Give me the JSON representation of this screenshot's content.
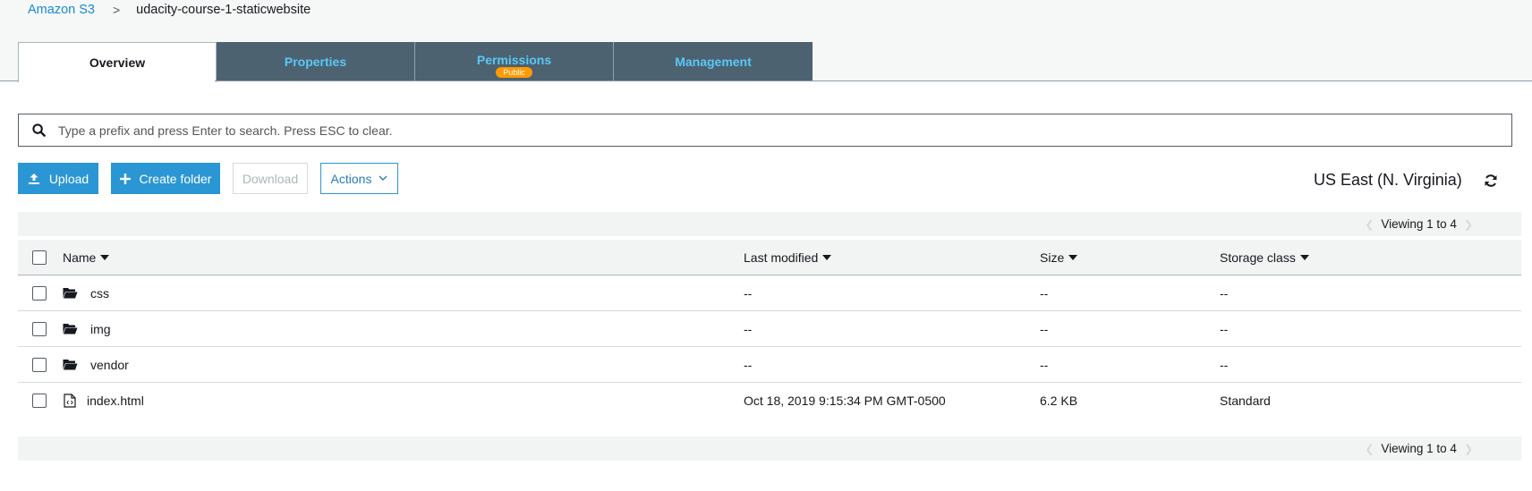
{
  "breadcrumb": {
    "root": "Amazon S3",
    "separator": ">",
    "current": "udacity-course-1-staticwebsite"
  },
  "tabs": [
    {
      "label": "Overview",
      "active": true
    },
    {
      "label": "Properties"
    },
    {
      "label": "Permissions",
      "badge": "Public"
    },
    {
      "label": "Management"
    }
  ],
  "search": {
    "placeholder": "Type a prefix and press Enter to search. Press ESC to clear.",
    "value": ""
  },
  "toolbar": {
    "upload": "Upload",
    "create_folder": "Create folder",
    "download": "Download",
    "actions": "Actions"
  },
  "region": "US East (N. Virginia)",
  "viewing": "Viewing 1 to 4",
  "table": {
    "columns": [
      "Name",
      "Last modified",
      "Size",
      "Storage class"
    ],
    "rows": [
      {
        "type": "folder",
        "name": "css",
        "modified": "--",
        "size": "--",
        "storage": "--"
      },
      {
        "type": "folder",
        "name": "img",
        "modified": "--",
        "size": "--",
        "storage": "--"
      },
      {
        "type": "folder",
        "name": "vendor",
        "modified": "--",
        "size": "--",
        "storage": "--"
      },
      {
        "type": "file",
        "name": "index.html",
        "modified": "Oct 18, 2019 9:15:34 PM GMT-0500",
        "size": "6.2 KB",
        "storage": "Standard"
      }
    ]
  },
  "colors": {
    "accent": "#2b96d4",
    "tab_bg": "#4c6271",
    "tab_text": "#5ac8f5",
    "badge": "#ff9900"
  }
}
